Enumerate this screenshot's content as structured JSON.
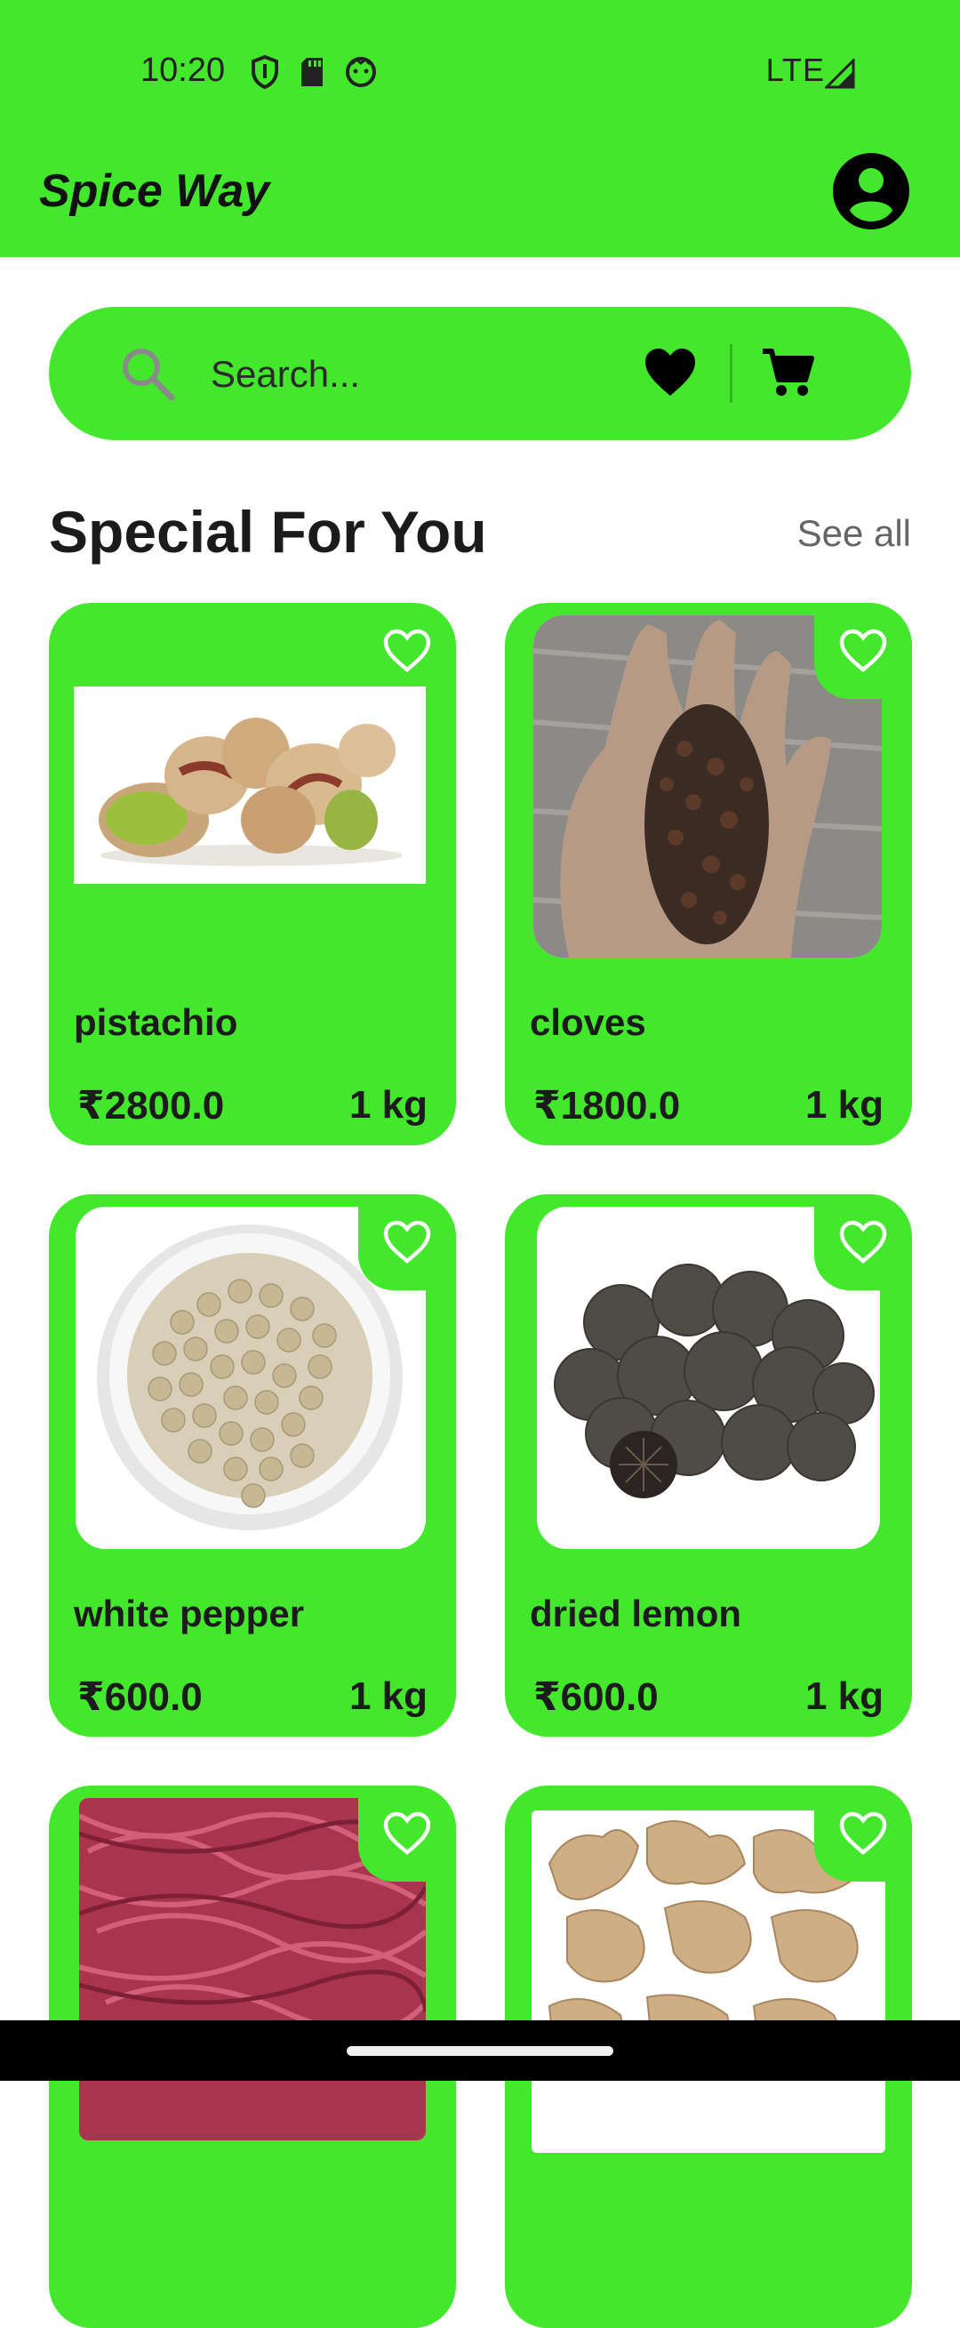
{
  "status_bar": {
    "time": "10:20",
    "network": "LTE"
  },
  "app_bar": {
    "title": "Spice Way"
  },
  "search": {
    "placeholder": "Search..."
  },
  "section": {
    "title": "Special For You",
    "see_all": "See all"
  },
  "products": [
    {
      "name": "pistachio",
      "price": "₹2800.0",
      "unit": "1 kg"
    },
    {
      "name": "cloves",
      "price": "₹1800.0",
      "unit": "1 kg"
    },
    {
      "name": "white pepper",
      "price": "₹600.0",
      "unit": "1 kg"
    },
    {
      "name": "dried lemon",
      "price": "₹600.0",
      "unit": "1 kg"
    },
    {
      "name": "",
      "price": "",
      "unit": ""
    },
    {
      "name": "",
      "price": "",
      "unit": ""
    }
  ],
  "colors": {
    "accent": "#43e82c",
    "text": "#1b1b1b",
    "muted": "#666666"
  },
  "icons": [
    "shield-icon",
    "sd-card-icon",
    "face-icon",
    "signal-icon",
    "account-icon",
    "search-icon",
    "heart-filled-icon",
    "cart-icon",
    "heart-outline-icon"
  ]
}
